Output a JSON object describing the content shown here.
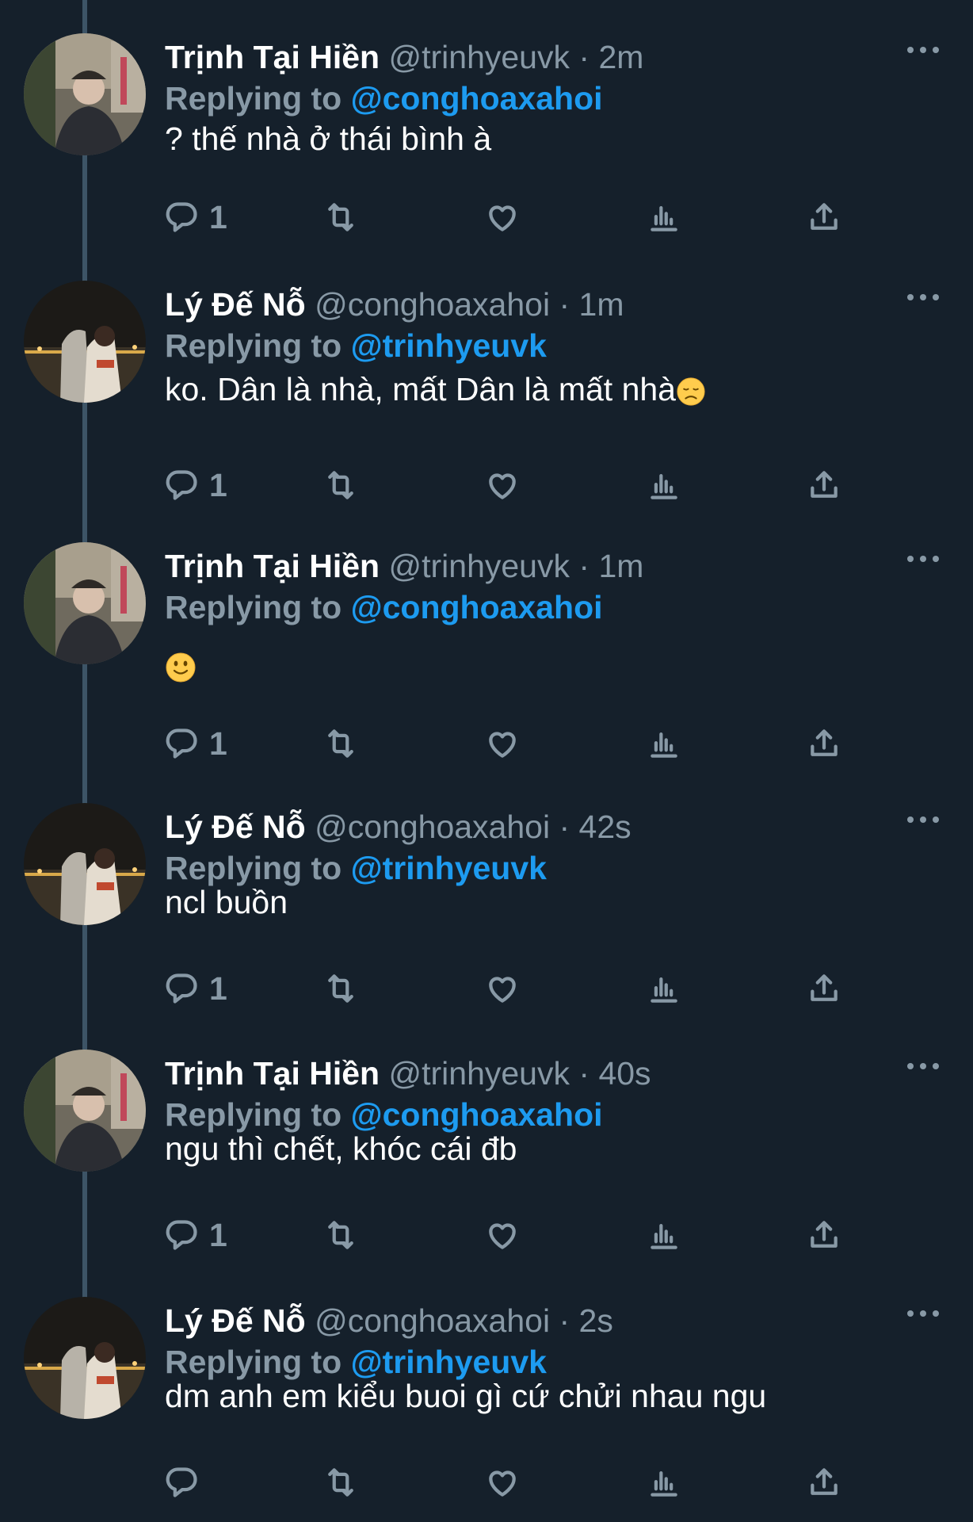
{
  "colors": {
    "background": "#15202b",
    "text": "#ffffff",
    "muted": "#8899a6",
    "link": "#1d9bf0",
    "thread_line": "#3d5466"
  },
  "icons": {
    "reply": "reply-icon",
    "retweet": "retweet-icon",
    "like": "heart-icon",
    "analytics": "analytics-icon",
    "share": "share-icon",
    "more": "more-icon"
  },
  "tweets": [
    {
      "name": "Trịnh Tại Hiền",
      "handle": "@trinhyeuvk",
      "dot": "·",
      "time": "2m",
      "reply_prefix": "Replying to",
      "reply_to": "@conghoaxahoi",
      "text": "? thế nhà ở thái bình à",
      "emoji": "",
      "reply_count": "1"
    },
    {
      "name": "Lý Đế Nỗ",
      "handle": "@conghoaxahoi",
      "dot": "·",
      "time": "1m",
      "reply_prefix": "Replying to",
      "reply_to": "@trinhyeuvk",
      "text": "ko. Dân là nhà, mất Dân là mất nhà",
      "emoji": "disappointed-face",
      "reply_count": "1"
    },
    {
      "name": "Trịnh Tại Hiền",
      "handle": "@trinhyeuvk",
      "dot": "·",
      "time": "1m",
      "reply_prefix": "Replying to",
      "reply_to": "@conghoaxahoi",
      "text": "",
      "emoji": "slightly-smiling-face",
      "reply_count": "1"
    },
    {
      "name": "Lý Đế Nỗ",
      "handle": "@conghoaxahoi",
      "dot": "·",
      "time": "42s",
      "reply_prefix": "Replying to",
      "reply_to": "@trinhyeuvk",
      "text": "ncl buồn",
      "emoji": "",
      "reply_count": "1"
    },
    {
      "name": "Trịnh Tại Hiền",
      "handle": "@trinhyeuvk",
      "dot": "·",
      "time": "40s",
      "reply_prefix": "Replying to",
      "reply_to": "@conghoaxahoi",
      "text": "ngu thì chết, khóc cái đb",
      "emoji": "",
      "reply_count": "1"
    },
    {
      "name": "Lý Đế Nỗ",
      "handle": "@conghoaxahoi",
      "dot": "·",
      "time": "2s",
      "reply_prefix": "Replying to",
      "reply_to": "@trinhyeuvk",
      "text": "dm anh em kiểu buoi gì cứ chửi nhau ngu",
      "emoji": "",
      "reply_count": ""
    }
  ]
}
